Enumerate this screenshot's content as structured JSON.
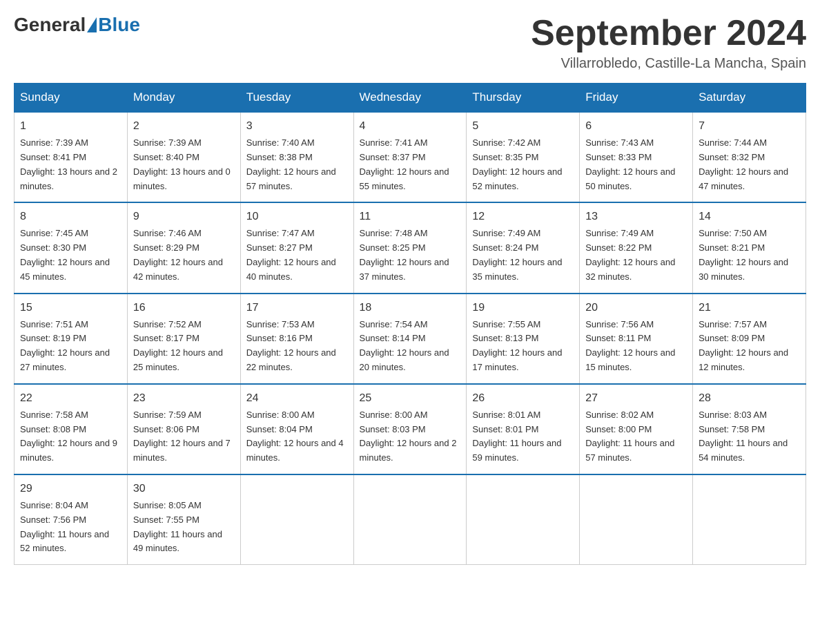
{
  "header": {
    "logo": {
      "text_general": "General",
      "text_blue": "Blue"
    },
    "title": "September 2024",
    "location": "Villarrobledo, Castille-La Mancha, Spain"
  },
  "calendar": {
    "days_of_week": [
      "Sunday",
      "Monday",
      "Tuesday",
      "Wednesday",
      "Thursday",
      "Friday",
      "Saturday"
    ],
    "weeks": [
      [
        {
          "day": "1",
          "sunrise": "7:39 AM",
          "sunset": "8:41 PM",
          "daylight": "13 hours and 2 minutes."
        },
        {
          "day": "2",
          "sunrise": "7:39 AM",
          "sunset": "8:40 PM",
          "daylight": "13 hours and 0 minutes."
        },
        {
          "day": "3",
          "sunrise": "7:40 AM",
          "sunset": "8:38 PM",
          "daylight": "12 hours and 57 minutes."
        },
        {
          "day": "4",
          "sunrise": "7:41 AM",
          "sunset": "8:37 PM",
          "daylight": "12 hours and 55 minutes."
        },
        {
          "day": "5",
          "sunrise": "7:42 AM",
          "sunset": "8:35 PM",
          "daylight": "12 hours and 52 minutes."
        },
        {
          "day": "6",
          "sunrise": "7:43 AM",
          "sunset": "8:33 PM",
          "daylight": "12 hours and 50 minutes."
        },
        {
          "day": "7",
          "sunrise": "7:44 AM",
          "sunset": "8:32 PM",
          "daylight": "12 hours and 47 minutes."
        }
      ],
      [
        {
          "day": "8",
          "sunrise": "7:45 AM",
          "sunset": "8:30 PM",
          "daylight": "12 hours and 45 minutes."
        },
        {
          "day": "9",
          "sunrise": "7:46 AM",
          "sunset": "8:29 PM",
          "daylight": "12 hours and 42 minutes."
        },
        {
          "day": "10",
          "sunrise": "7:47 AM",
          "sunset": "8:27 PM",
          "daylight": "12 hours and 40 minutes."
        },
        {
          "day": "11",
          "sunrise": "7:48 AM",
          "sunset": "8:25 PM",
          "daylight": "12 hours and 37 minutes."
        },
        {
          "day": "12",
          "sunrise": "7:49 AM",
          "sunset": "8:24 PM",
          "daylight": "12 hours and 35 minutes."
        },
        {
          "day": "13",
          "sunrise": "7:49 AM",
          "sunset": "8:22 PM",
          "daylight": "12 hours and 32 minutes."
        },
        {
          "day": "14",
          "sunrise": "7:50 AM",
          "sunset": "8:21 PM",
          "daylight": "12 hours and 30 minutes."
        }
      ],
      [
        {
          "day": "15",
          "sunrise": "7:51 AM",
          "sunset": "8:19 PM",
          "daylight": "12 hours and 27 minutes."
        },
        {
          "day": "16",
          "sunrise": "7:52 AM",
          "sunset": "8:17 PM",
          "daylight": "12 hours and 25 minutes."
        },
        {
          "day": "17",
          "sunrise": "7:53 AM",
          "sunset": "8:16 PM",
          "daylight": "12 hours and 22 minutes."
        },
        {
          "day": "18",
          "sunrise": "7:54 AM",
          "sunset": "8:14 PM",
          "daylight": "12 hours and 20 minutes."
        },
        {
          "day": "19",
          "sunrise": "7:55 AM",
          "sunset": "8:13 PM",
          "daylight": "12 hours and 17 minutes."
        },
        {
          "day": "20",
          "sunrise": "7:56 AM",
          "sunset": "8:11 PM",
          "daylight": "12 hours and 15 minutes."
        },
        {
          "day": "21",
          "sunrise": "7:57 AM",
          "sunset": "8:09 PM",
          "daylight": "12 hours and 12 minutes."
        }
      ],
      [
        {
          "day": "22",
          "sunrise": "7:58 AM",
          "sunset": "8:08 PM",
          "daylight": "12 hours and 9 minutes."
        },
        {
          "day": "23",
          "sunrise": "7:59 AM",
          "sunset": "8:06 PM",
          "daylight": "12 hours and 7 minutes."
        },
        {
          "day": "24",
          "sunrise": "8:00 AM",
          "sunset": "8:04 PM",
          "daylight": "12 hours and 4 minutes."
        },
        {
          "day": "25",
          "sunrise": "8:00 AM",
          "sunset": "8:03 PM",
          "daylight": "12 hours and 2 minutes."
        },
        {
          "day": "26",
          "sunrise": "8:01 AM",
          "sunset": "8:01 PM",
          "daylight": "11 hours and 59 minutes."
        },
        {
          "day": "27",
          "sunrise": "8:02 AM",
          "sunset": "8:00 PM",
          "daylight": "11 hours and 57 minutes."
        },
        {
          "day": "28",
          "sunrise": "8:03 AM",
          "sunset": "7:58 PM",
          "daylight": "11 hours and 54 minutes."
        }
      ],
      [
        {
          "day": "29",
          "sunrise": "8:04 AM",
          "sunset": "7:56 PM",
          "daylight": "11 hours and 52 minutes."
        },
        {
          "day": "30",
          "sunrise": "8:05 AM",
          "sunset": "7:55 PM",
          "daylight": "11 hours and 49 minutes."
        },
        null,
        null,
        null,
        null,
        null
      ]
    ]
  }
}
